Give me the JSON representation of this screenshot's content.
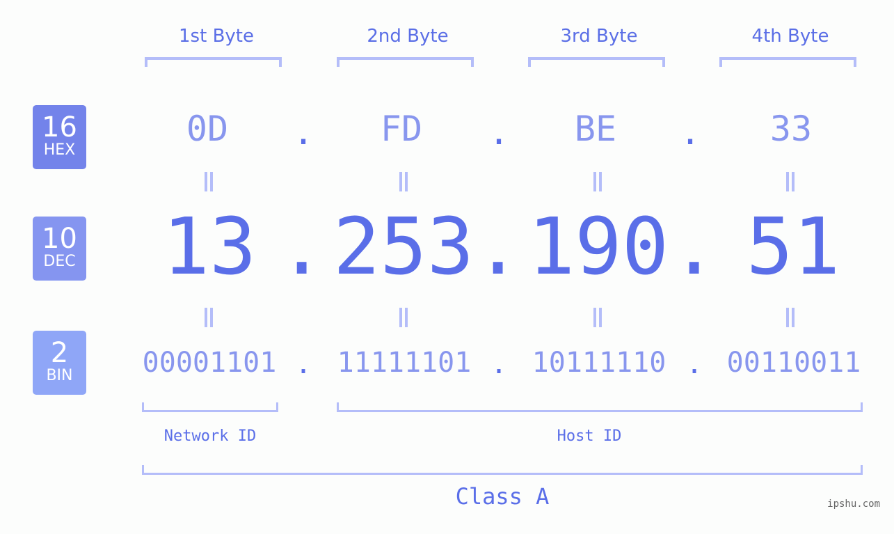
{
  "ip": {
    "dotted_decimal": "13.253.190.51",
    "bytes": [
      {
        "label": "1st Byte",
        "hex": "0D",
        "dec": "13",
        "bin": "00001101"
      },
      {
        "label": "2nd Byte",
        "hex": "FD",
        "dec": "253",
        "bin": "11111101"
      },
      {
        "label": "3rd Byte",
        "hex": "BE",
        "dec": "190",
        "bin": "10111110"
      },
      {
        "label": "4th Byte",
        "hex": "33",
        "dec": "51",
        "bin": "00110011"
      }
    ],
    "separator": "."
  },
  "bases": [
    {
      "num": "16",
      "label": "HEX",
      "color": "#7383ea"
    },
    {
      "num": "10",
      "label": "DEC",
      "color": "#8595f0"
    },
    {
      "num": "2",
      "label": "BIN",
      "color": "#8fa6f7"
    }
  ],
  "segments": {
    "network": "Network ID",
    "host": "Host ID",
    "class": "Class A"
  },
  "watermark": "ipshu.com",
  "colors": {
    "primary": "#5a6ee8",
    "light": "#8896ee",
    "bracket": "#b4bdf9",
    "background": "#fcfdfc"
  }
}
